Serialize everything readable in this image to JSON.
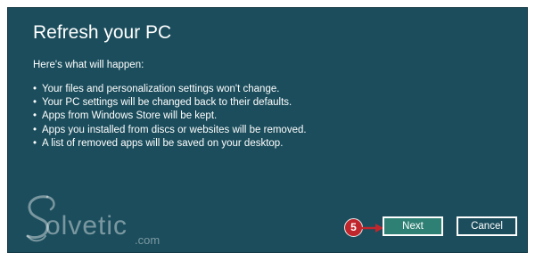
{
  "dialog": {
    "title": "Refresh your PC",
    "subtitle": "Here's what will happen:",
    "bullets": [
      "Your files and personalization settings won't change.",
      "Your PC settings will be changed back to their defaults.",
      "Apps from Windows Store will be kept.",
      "Apps you installed from discs or websites will be removed.",
      "A list of removed apps will be saved on your desktop."
    ],
    "bullet_symbol": "•",
    "background_color": "#1b4d5c",
    "next_button_color": "#2e8074"
  },
  "buttons": {
    "next_label": "Next",
    "cancel_label": "Cancel"
  },
  "step_marker": {
    "number": "5",
    "color": "#c0272d"
  },
  "watermark": {
    "brand": "olvetic",
    "suffix": ".com",
    "logo_icon": "solvetic-swirl-icon"
  }
}
